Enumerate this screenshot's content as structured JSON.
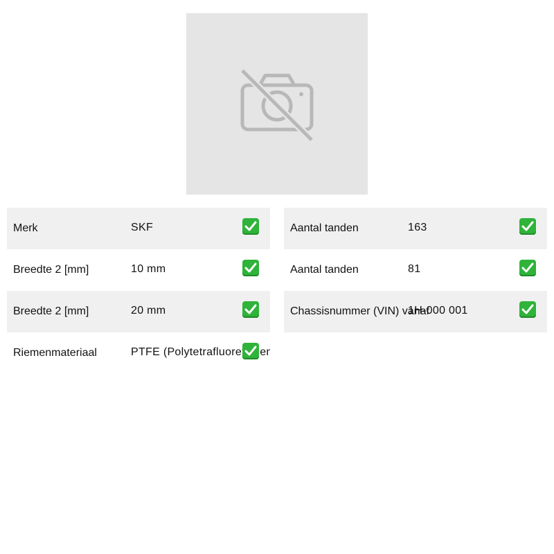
{
  "image": {
    "icon": "no-camera-icon",
    "background_color": "#e5e5e5",
    "icon_color": "#b8b8b8"
  },
  "left_table": [
    {
      "label": "Merk",
      "value": "SKF",
      "icon": "check-icon"
    },
    {
      "label": "Breedte 2 [mm]",
      "value": "10 mm",
      "icon": "check-icon"
    },
    {
      "label": "Breedte 2 [mm]",
      "value": "20 mm",
      "icon": "check-icon"
    },
    {
      "label": "Riemenmateriaal",
      "value": "PTFE (Polytetrafluorethylen)",
      "icon": "check-icon"
    }
  ],
  "right_table": [
    {
      "label": "Aantal tanden",
      "value": "163",
      "icon": "check-icon"
    },
    {
      "label": "Aantal tanden",
      "value": "81",
      "icon": "check-icon"
    },
    {
      "label": "Chassisnummer (VIN) vanaf",
      "value": "1H-000 001",
      "icon": "check-icon"
    }
  ],
  "colors": {
    "row_shade": "#f0f0f0",
    "check_green": "#2fb33a"
  }
}
